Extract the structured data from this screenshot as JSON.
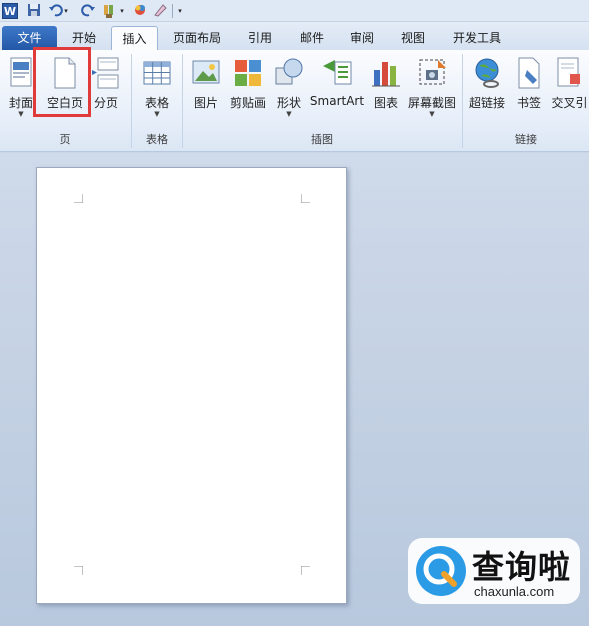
{
  "quick_access": {
    "icons": [
      "word-app-icon",
      "save-icon",
      "undo-icon",
      "undo-dropdown-icon",
      "redo-icon",
      "format-painter-icon",
      "color-icon",
      "clear-icon",
      "customize-dropdown-icon"
    ],
    "app_letter": "W"
  },
  "tabs": [
    {
      "label": "文件",
      "active": false
    },
    {
      "label": "开始",
      "active": false
    },
    {
      "label": "插入",
      "active": true
    },
    {
      "label": "页面布局",
      "active": false
    },
    {
      "label": "引用",
      "active": false
    },
    {
      "label": "邮件",
      "active": false
    },
    {
      "label": "审阅",
      "active": false
    },
    {
      "label": "视图",
      "active": false
    },
    {
      "label": "开发工具",
      "active": false
    }
  ],
  "ribbon": {
    "groups": {
      "pages": "页",
      "tables": "表格",
      "illustrations": "插图",
      "links": "链接"
    },
    "buttons": {
      "cover": "封面",
      "blank_page": "空白页",
      "page_break": "分页",
      "table": "表格",
      "picture": "图片",
      "clipart": "剪贴画",
      "shapes": "形状",
      "smartart": "SmartArt",
      "chart": "图表",
      "screenshot": "屏幕截图",
      "hyperlink": "超链接",
      "bookmark": "书签",
      "cross_ref": "交叉引"
    },
    "dropdown_arrow": "▼"
  },
  "watermark": {
    "title": "查询啦",
    "subtitle": "chaxunla.com"
  }
}
